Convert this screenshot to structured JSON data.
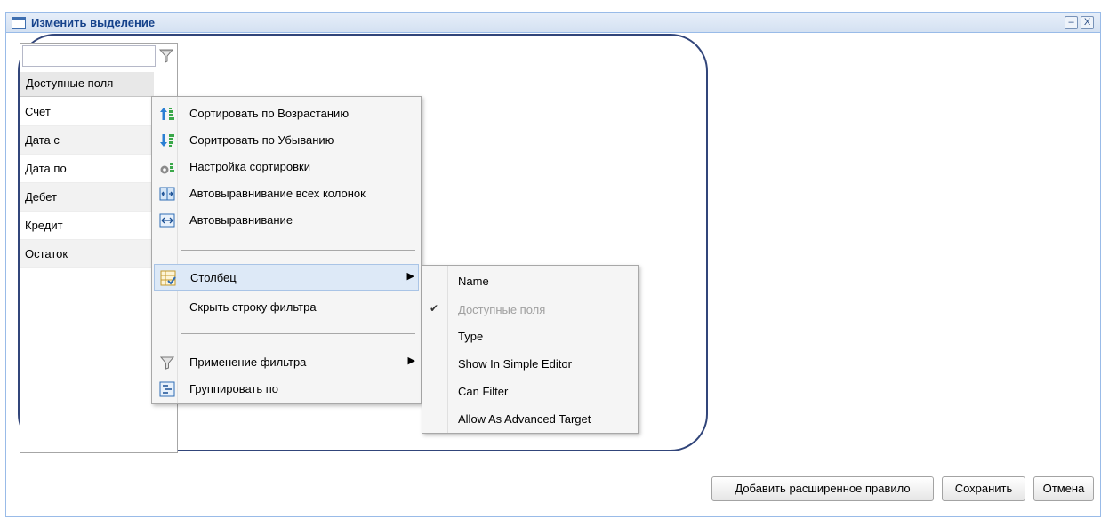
{
  "window": {
    "title": "Изменить выделение",
    "minimize_glyph": "–",
    "close_glyph": "X"
  },
  "grid": {
    "filter_value": "",
    "header": "Доступные поля",
    "rows": [
      "Счет",
      "Дата с",
      "Дата по",
      "Дебет",
      "Кредит",
      "Остаток"
    ]
  },
  "context_menu": {
    "items": [
      {
        "label": "Сортировать по Возрастанию",
        "icon": "sort-ascending-icon"
      },
      {
        "label": "Соритровать по Убыванию",
        "icon": "sort-descending-icon"
      },
      {
        "label": "Настройка сортировки",
        "icon": "sort-settings-icon"
      },
      {
        "label": "Автовыравнивание всех колонок",
        "icon": "autofit-all-columns-icon"
      },
      {
        "label": "Автовыравнивание",
        "icon": "autofit-icon"
      },
      {
        "label": "Столбец",
        "icon": "columns-icon",
        "submenu": true,
        "active": true
      },
      {
        "label": "Скрыть строку фильтра",
        "icon": ""
      },
      {
        "label": "Применение фильтра",
        "icon": "filter-icon",
        "submenu": true
      },
      {
        "label": "Группировать по",
        "icon": "group-by-icon"
      }
    ],
    "submenu_arrow": "▶"
  },
  "column_submenu": {
    "items": [
      {
        "label": "Name",
        "checked": false,
        "disabled": false
      },
      {
        "label": "Доступные поля",
        "checked": true,
        "disabled": true
      },
      {
        "label": "Type",
        "checked": false,
        "disabled": false
      },
      {
        "label": "Show In Simple Editor",
        "checked": false,
        "disabled": false
      },
      {
        "label": "Can Filter",
        "checked": false,
        "disabled": false
      },
      {
        "label": "Allow As Advanced Target",
        "checked": false,
        "disabled": false
      }
    ],
    "check_glyph": "✔"
  },
  "footer": {
    "add_rule_label": "Добавить расширенное правило",
    "save_label": "Сохранить",
    "cancel_label": "Отмена"
  },
  "colors": {
    "title_text": "#15428b",
    "frame_outline": "#31457a",
    "menu_bg": "#f5f5f5",
    "menu_active": "#dde9f7"
  }
}
